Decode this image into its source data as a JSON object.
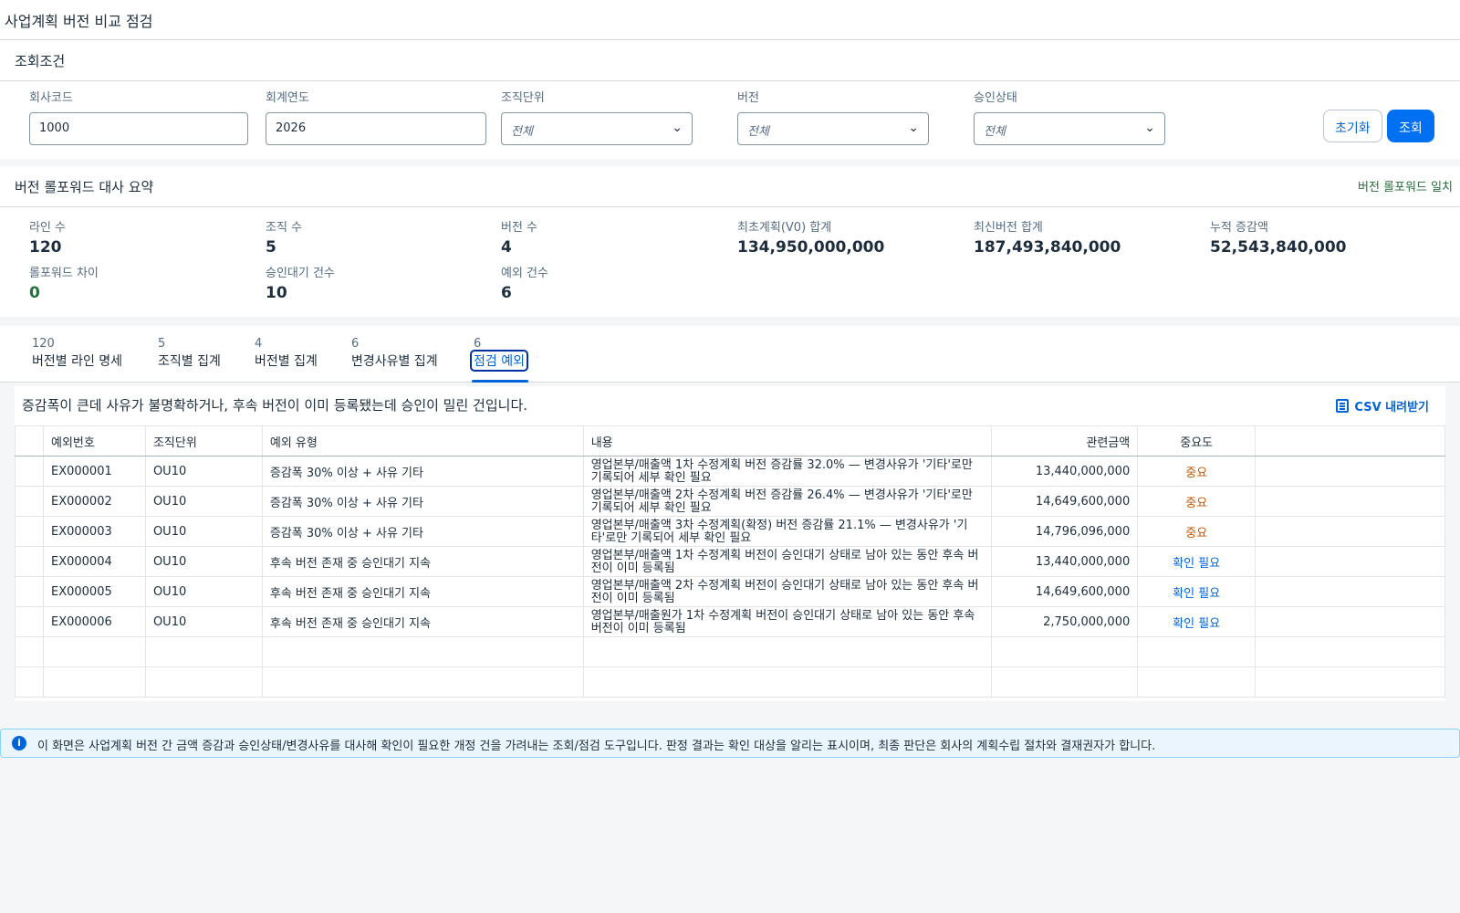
{
  "page": {
    "title": "사업계획 버전 비교 점검"
  },
  "filters": {
    "title": "조회조건",
    "fields": [
      {
        "label": "회사코드",
        "value": "1000",
        "type": "input"
      },
      {
        "label": "회계연도",
        "value": "2026",
        "type": "input"
      },
      {
        "label": "조직단위",
        "value": "전체",
        "type": "select"
      },
      {
        "label": "버전",
        "value": "전체",
        "type": "select"
      },
      {
        "label": "승인상태",
        "value": "전체",
        "type": "select"
      }
    ],
    "reset_label": "초기화",
    "search_label": "조회"
  },
  "summary": {
    "title": "버전 롤포워드 대사 요약",
    "status": "버전 롤포워드 일치",
    "stats": [
      {
        "label": "라인 수",
        "value": "120"
      },
      {
        "label": "조직 수",
        "value": "5"
      },
      {
        "label": "버전 수",
        "value": "4"
      },
      {
        "label": "최초계획(V0) 합계",
        "value": "134,950,000,000"
      },
      {
        "label": "최신버전 합계",
        "value": "187,493,840,000"
      },
      {
        "label": "누적 증감액",
        "value": "52,543,840,000"
      },
      {
        "label": "롤포워드 차이",
        "value": "0"
      },
      {
        "label": "승인대기 건수",
        "value": "10"
      },
      {
        "label": "예외 건수",
        "value": "6"
      }
    ]
  },
  "tabs": [
    {
      "count": "120",
      "label": "버전별 라인 명세"
    },
    {
      "count": "5",
      "label": "조직별 집계"
    },
    {
      "count": "4",
      "label": "버전별 집계"
    },
    {
      "count": "6",
      "label": "변경사유별 집계"
    },
    {
      "count": "6",
      "label": "점검 예외"
    }
  ],
  "exceptions": {
    "description": "증감폭이 큰데 사유가 불명확하거나, 후속 버전이 이미 등록됐는데 승인이 밀린 건입니다.",
    "csv_label": "CSV 내려받기",
    "columns": [
      "예외번호",
      "조직단위",
      "예외 유형",
      "내용",
      "관련금액",
      "중요도"
    ],
    "rows": [
      {
        "id": "EX000001",
        "org": "OU10",
        "type": "증감폭 30% 이상 + 사유 기타",
        "content": "영업본부/매출액 1차 수정계획 버전 증감률 32.0% — 변경사유가 '기타'로만 기록되어 세부 확인 필요",
        "amount": "13,440,000,000",
        "severity": "중요"
      },
      {
        "id": "EX000002",
        "org": "OU10",
        "type": "증감폭 30% 이상 + 사유 기타",
        "content": "영업본부/매출액 2차 수정계획 버전 증감률 26.4% — 변경사유가 '기타'로만 기록되어 세부 확인 필요",
        "amount": "14,649,600,000",
        "severity": "중요"
      },
      {
        "id": "EX000003",
        "org": "OU10",
        "type": "증감폭 30% 이상 + 사유 기타",
        "content": "영업본부/매출액 3차 수정계획(확정) 버전 증감률 21.1% — 변경사유가 '기타'로만 기록되어 세부 확인 필요",
        "amount": "14,796,096,000",
        "severity": "중요"
      },
      {
        "id": "EX000004",
        "org": "OU10",
        "type": "후속 버전 존재 중 승인대기 지속",
        "content": "영업본부/매출액 1차 수정계획 버전이 승인대기 상태로 남아 있는 동안 후속 버전이 이미 등록됨",
        "amount": "13,440,000,000",
        "severity": "확인 필요"
      },
      {
        "id": "EX000005",
        "org": "OU10",
        "type": "후속 버전 존재 중 승인대기 지속",
        "content": "영업본부/매출액 2차 수정계획 버전이 승인대기 상태로 남아 있는 동안 후속 버전이 이미 등록됨",
        "amount": "14,649,600,000",
        "severity": "확인 필요"
      },
      {
        "id": "EX000006",
        "org": "OU10",
        "type": "후속 버전 존재 중 승인대기 지속",
        "content": "영업본부/매출원가 1차 수정계획 버전이 승인대기 상태로 남아 있는 동안 후속 버전이 이미 등록됨",
        "amount": "2,750,000,000",
        "severity": "확인 필요"
      }
    ]
  },
  "notice": {
    "text": "이 화면은 사업계획 버전 간 금액 증감과 승인상태/변경사유를 대사해 확인이 필요한 개정 건을 가려내는 조회/점검 도구입니다. 판정 결과는 확인 대상을 알리는 표시이며, 최종 판단은 회사의 계획수립 절차와 결재권자가 합니다."
  },
  "colors": {
    "accent": "#0070f2",
    "success": "#256f3a",
    "warning": "#c35500",
    "info": "#0064d9"
  }
}
